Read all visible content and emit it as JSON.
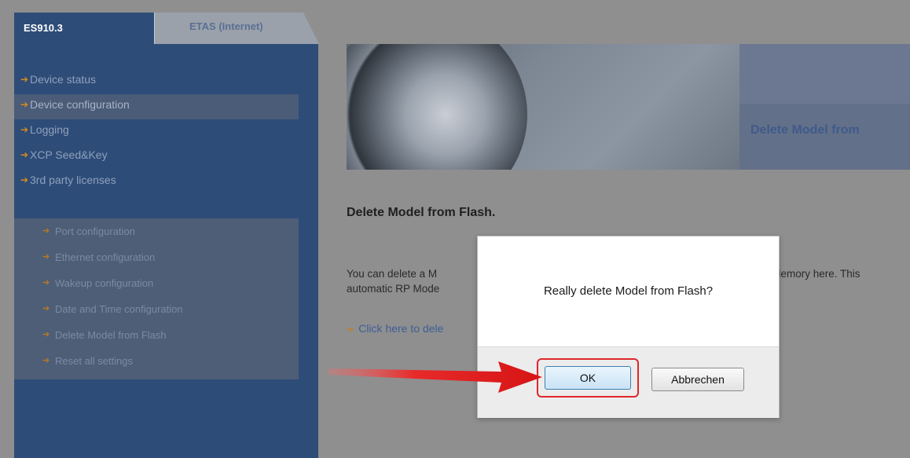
{
  "tabs": {
    "active": "ES910.3",
    "inactive": "ETAS (Internet)"
  },
  "nav": {
    "items": [
      {
        "label": "Device status"
      },
      {
        "label": "Device configuration"
      },
      {
        "label": "Logging"
      },
      {
        "label": "XCP Seed&Key"
      },
      {
        "label": "3rd party licenses"
      }
    ],
    "sub_items": [
      {
        "label": "Port configuration"
      },
      {
        "label": "Ethernet configuration"
      },
      {
        "label": "Wakeup configuration"
      },
      {
        "label": "Date and Time configuration"
      },
      {
        "label": "Delete Model from Flash"
      },
      {
        "label": "Reset all settings"
      }
    ]
  },
  "banner": {
    "title": "Delete Model from"
  },
  "content": {
    "heading": "Delete Model from Flash.",
    "paragraph_line1_left": "You can delete a M",
    "paragraph_line1_right": "h Memory here. This",
    "paragraph_line2": "automatic RP Mode",
    "link": "Click here to dele"
  },
  "dialog": {
    "message": "Really delete Model from Flash?",
    "ok_label": "OK",
    "cancel_label": "Abbrechen"
  },
  "colors": {
    "nav_background": "#2e4c78",
    "accent_bullet": "#d88a1f",
    "highlight_red": "#e0262a"
  }
}
